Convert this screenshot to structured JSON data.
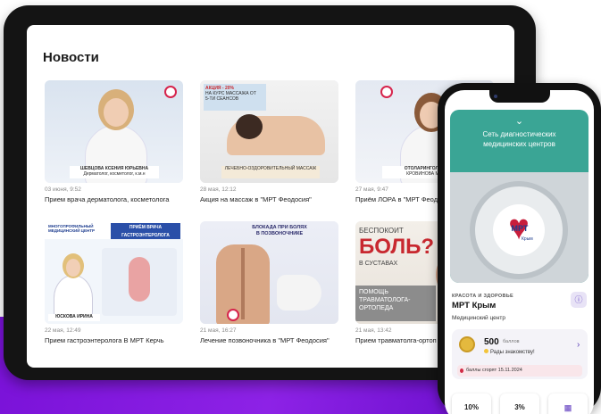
{
  "tablet": {
    "heading": "Новости",
    "cards": [
      {
        "date": "03 июня, 9:52",
        "title": "Прием врача дерматолога, косметолога",
        "img_name": "ШЕВЦОВА КСЕНИЯ ЮРЬЕВНА",
        "img_role": "Дерматолог, косметолог, к.м.н"
      },
      {
        "date": "28 мая, 12:12",
        "title": "Акция на массаж в \"МРТ Феодосия\"",
        "img_promo_1": "АКЦИЯ - 20%",
        "img_promo_2": "НА КУРС МАССАЖА ОТ",
        "img_promo_3": "5-ТИ СЕАНСОВ",
        "img_caption": "ЛЕЧЕБНО-ОЗДОРОВИТЕЛЬНЫЙ МАССАЖ"
      },
      {
        "date": "27 мая, 9:47",
        "title": "Приём ЛОРА в \"МРТ Феод",
        "img_caption": "ОТОЛАРИНГОЛОГ (ЛОР)",
        "img_name": "КРОВИНОВА МАРИЯ О"
      },
      {
        "date": "22 мая, 12:49",
        "title": "Прием гастроэнтеролога В МРТ Керчь",
        "img_head": "ПРИЁМ ВРАЧА ГАСТРОЭНТЕРОЛОГА",
        "img_center": "МНОГОПРОФИЛЬНЫЙ МЕДИЦИНСКИЙ ЦЕНТР",
        "img_name": "ЮСКОВА ИРИНА"
      },
      {
        "date": "21 мая, 16:27",
        "title": "Лечение позвоночника в \"МРТ Феодосия\"",
        "img_head_1": "БЛОКАДА ПРИ БОЛЯХ",
        "img_head_2": "В ПОЗВОНОЧНИКЕ"
      },
      {
        "date": "21 мая, 13:42",
        "title": "Прием травматолга-ортоп",
        "img_line_1": "БЕСПОКОИТ",
        "img_line_2": "БОЛЬ?",
        "img_line_3": "В СУСТАВАХ",
        "img_line_4": "ПОМОЩЬ",
        "img_line_5": "ТРАВМАТОЛОГА-",
        "img_line_6": "ОРТОПЕДА"
      }
    ]
  },
  "phone": {
    "hero_line_1": "Сеть диагностических",
    "hero_line_2": "медицинских центров",
    "logo_text": "МРТ",
    "logo_sub": "Крым",
    "category": "КРАСОТА И ЗДОРОВЬЕ",
    "brand": "МРТ Крым",
    "subtitle": "Медицинский центр",
    "points_value": "500",
    "points_unit": "баллов",
    "greeting": "Рады знакомству!",
    "expire": "баллы сгорят 15.11.2024",
    "tile_1": "10%",
    "tile_2": "3%"
  },
  "colors": {
    "accent_purple": "#8d22e6",
    "hero_teal": "#3aa595",
    "brand_red": "#c81e3c"
  },
  "icons": [
    "chevron-down-icon",
    "info-icon",
    "chevron-right-icon",
    "medal-icon",
    "flame-icon",
    "qr-icon"
  ]
}
